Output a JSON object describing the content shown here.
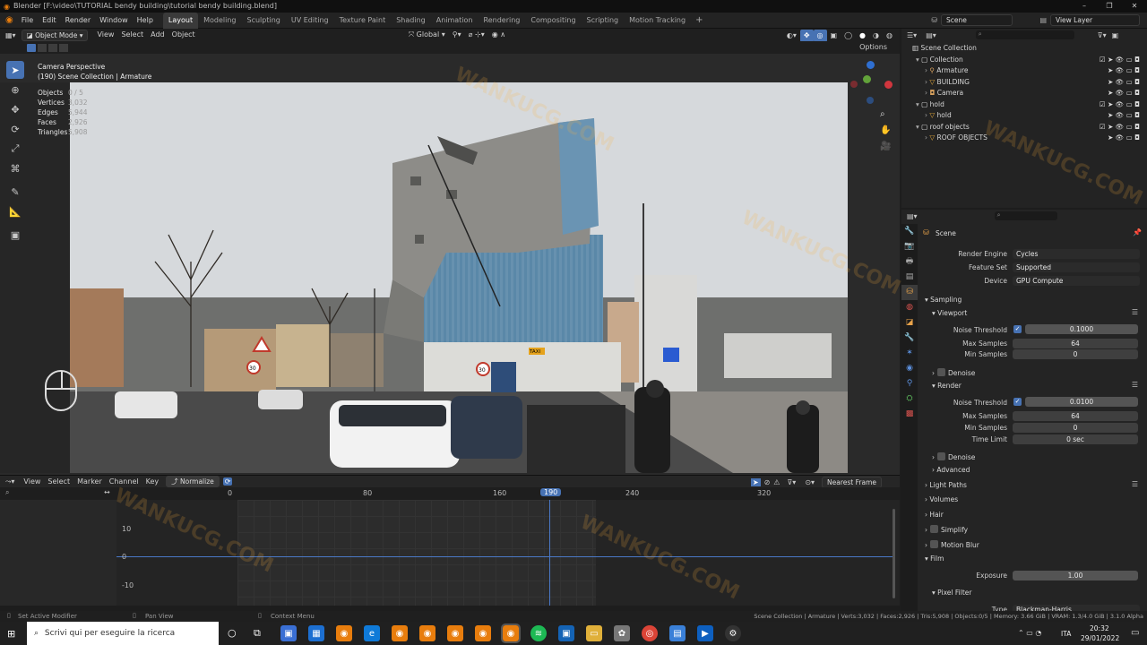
{
  "window": {
    "title": "Blender [F:\\video\\TUTORIAL bendy building\\tutorial bendy building.blend]"
  },
  "menus": [
    "File",
    "Edit",
    "Render",
    "Window",
    "Help"
  ],
  "workspaces": [
    "Layout",
    "Modeling",
    "Sculpting",
    "UV Editing",
    "Texture Paint",
    "Shading",
    "Animation",
    "Rendering",
    "Compositing",
    "Scripting",
    "Motion Tracking"
  ],
  "active_workspace": "Layout",
  "topright": {
    "scene": "Scene",
    "view_layer": "View Layer"
  },
  "viewport_header": {
    "mode": "Object Mode",
    "view": "View",
    "select": "Select",
    "add": "Add",
    "object": "Object",
    "orientation": "Global",
    "options": "Options"
  },
  "viewport": {
    "camera_label": "Camera Perspective",
    "collection_label": "(190) Scene Collection | Armature",
    "stats": [
      {
        "label": "Objects",
        "value": "0 / 5"
      },
      {
        "label": "Vertices",
        "value": "3,032"
      },
      {
        "label": "Edges",
        "value": "5,944"
      },
      {
        "label": "Faces",
        "value": "2,926"
      },
      {
        "label": "Triangles",
        "value": "5,908"
      }
    ],
    "signs": {
      "sign1": "30",
      "sign2": "30",
      "taxi": "TAXI"
    }
  },
  "timeline": {
    "menus": [
      "View",
      "Select",
      "Marker",
      "Channel",
      "Key"
    ],
    "normalize": "Normalize",
    "interpolation": "Nearest Frame",
    "ruler": [
      "0",
      "80",
      "160",
      "190",
      "240",
      "320"
    ],
    "current_frame": "190",
    "yticks": [
      "10",
      "0",
      "-10"
    ]
  },
  "outliner": {
    "root": "Scene Collection",
    "rows": [
      {
        "label": "Collection",
        "indent": 1,
        "type": "collection"
      },
      {
        "label": "Armature",
        "indent": 2,
        "type": "armature"
      },
      {
        "label": "BUILDING",
        "indent": 2,
        "type": "mesh"
      },
      {
        "label": "Camera",
        "indent": 2,
        "type": "camera"
      },
      {
        "label": "hold",
        "indent": 1,
        "type": "collection"
      },
      {
        "label": "hold",
        "indent": 2,
        "type": "mesh"
      },
      {
        "label": "roof objects",
        "indent": 1,
        "type": "collection"
      },
      {
        "label": "ROOF OBJECTS",
        "indent": 2,
        "type": "mesh"
      }
    ]
  },
  "properties": {
    "context": "Scene",
    "render_engine_label": "Render Engine",
    "render_engine": "Cycles",
    "feature_set_label": "Feature Set",
    "feature_set": "Supported",
    "device_label": "Device",
    "device": "GPU Compute",
    "sampling": "Sampling",
    "viewport": "Viewport",
    "vp_noise_label": "Noise Threshold",
    "vp_noise": "0.1000",
    "vp_max_label": "Max Samples",
    "vp_max": "64",
    "vp_min_label": "Min Samples",
    "vp_min": "0",
    "denoise": "Denoise",
    "render": "Render",
    "r_noise_label": "Noise Threshold",
    "r_noise": "0.0100",
    "r_max_label": "Max Samples",
    "r_max": "64",
    "r_min_label": "Min Samples",
    "r_min": "0",
    "r_time_label": "Time Limit",
    "r_time": "0 sec",
    "denoise2": "Denoise",
    "advanced": "Advanced",
    "light_paths": "Light Paths",
    "volumes": "Volumes",
    "hair": "Hair",
    "simplify": "Simplify",
    "motion_blur": "Motion Blur",
    "film": "Film",
    "exposure_label": "Exposure",
    "exposure": "1.00",
    "pixel_filter": "Pixel Filter",
    "type_label": "Type",
    "type": "Blackman-Harris"
  },
  "statusbar": {
    "left1": "Set Active Modifier",
    "left2": "Pan View",
    "left3": "Context Menu",
    "right": "Scene Collection | Armature | Verts:3,032 | Faces:2,926 | Tris:5,908 | Objects:0/5 | Memory: 3.66 GiB | VRAM: 1.3/4.0 GiB | 3.1.0 Alpha"
  },
  "taskbar": {
    "search_placeholder": "Scrivi qui per eseguire la ricerca",
    "lang": "ITA",
    "time": "20:32",
    "date": "29/01/2022"
  },
  "watermark": "WANKUCG.COM"
}
